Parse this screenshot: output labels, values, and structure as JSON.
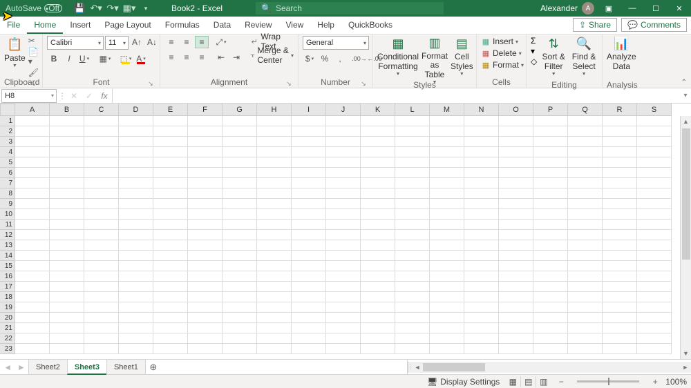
{
  "titlebar": {
    "autosave_label": "AutoSave",
    "autosave_state": "Off",
    "doc_title": "Book2 - Excel",
    "search_placeholder": "Search",
    "user_name": "Alexander",
    "user_initial": "A"
  },
  "tabs": {
    "file": "File",
    "list": [
      "Home",
      "Insert",
      "Page Layout",
      "Formulas",
      "Data",
      "Review",
      "View",
      "Help",
      "QuickBooks"
    ],
    "active": "Home",
    "share": "Share",
    "comments": "Comments"
  },
  "ribbon": {
    "clipboard": {
      "paste": "Paste",
      "label": "Clipboard"
    },
    "font": {
      "name": "Calibri",
      "size": "11",
      "label": "Font"
    },
    "alignment": {
      "wrap": "Wrap Text",
      "merge": "Merge & Center",
      "label": "Alignment"
    },
    "number": {
      "format": "General",
      "label": "Number"
    },
    "styles": {
      "cond": "Conditional Formatting",
      "table": "Format as Table",
      "cell": "Cell Styles",
      "label": "Styles"
    },
    "cells": {
      "insert": "Insert",
      "delete": "Delete",
      "format": "Format",
      "label": "Cells"
    },
    "editing": {
      "sort": "Sort & Filter",
      "find": "Find & Select",
      "label": "Editing"
    },
    "analysis": {
      "analyze": "Analyze Data",
      "label": "Analysis"
    }
  },
  "namebox": "H8",
  "columns": [
    "A",
    "B",
    "C",
    "D",
    "E",
    "F",
    "G",
    "H",
    "I",
    "J",
    "K",
    "L",
    "M",
    "N",
    "O",
    "P",
    "Q",
    "R",
    "S"
  ],
  "rows": [
    "1",
    "2",
    "3",
    "4",
    "5",
    "6",
    "7",
    "8",
    "9",
    "10",
    "11",
    "12",
    "13",
    "14",
    "15",
    "16",
    "17",
    "18",
    "19",
    "20",
    "21",
    "22",
    "23"
  ],
  "sheets": {
    "list": [
      "Sheet2",
      "Sheet3",
      "Sheet1"
    ],
    "active": "Sheet3"
  },
  "status": {
    "display": "Display Settings",
    "zoom": "100%"
  }
}
